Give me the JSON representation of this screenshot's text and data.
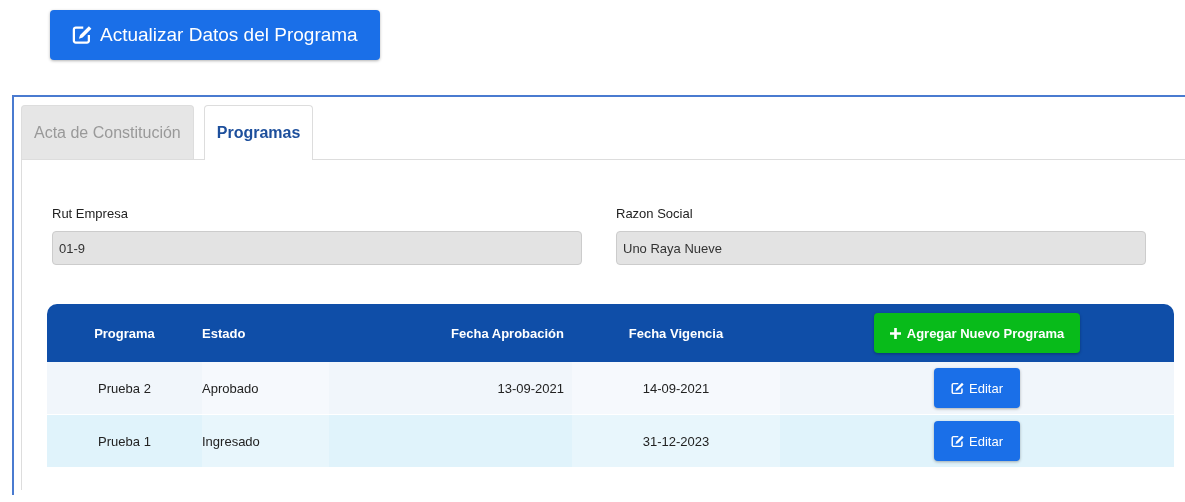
{
  "update_button": {
    "label": "Actualizar Datos del Programa"
  },
  "tabs": [
    {
      "label": "Acta de Constitución",
      "selected": false
    },
    {
      "label": "Programas",
      "selected": true
    }
  ],
  "fields": [
    {
      "label": "Rut Empresa",
      "value": "01-9"
    },
    {
      "label": "Razon Social",
      "value": "Uno Raya Nueve"
    }
  ],
  "table": {
    "columns": [
      "Programa",
      "Estado",
      "Fecha Aprobación",
      "Fecha Vigencia"
    ],
    "add_button": {
      "label": "Agregar Nuevo Programa"
    },
    "rows": [
      {
        "programa": "Prueba 2",
        "estado": "Aprobado",
        "fecha_aprobacion": "13-09-2021",
        "fecha_vigencia": "14-09-2021",
        "action": "Editar"
      },
      {
        "programa": "Prueba 1",
        "estado": "Ingresado",
        "fecha_vigencia": "31-12-2023",
        "action": "Editar"
      }
    ]
  }
}
